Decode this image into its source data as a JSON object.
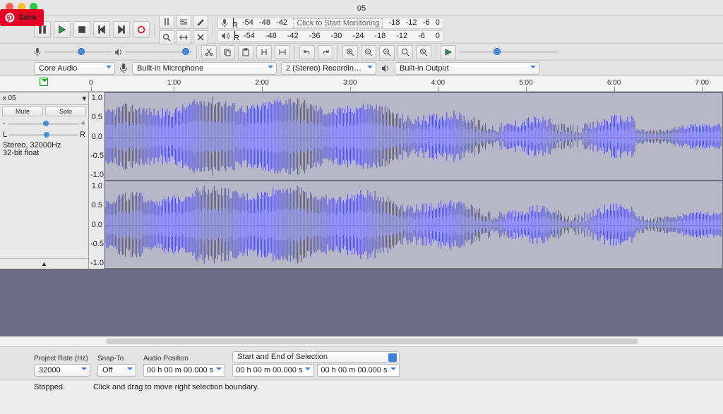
{
  "window": {
    "title": "05"
  },
  "pin_save": {
    "label": "Save"
  },
  "meters": {
    "rec_ticks": [
      "-54",
      "-48",
      "-42",
      "Click to Start Monitoring",
      "-18",
      "-12",
      "-6",
      "0"
    ],
    "play_ticks": [
      "-54",
      "-48",
      "-42",
      "-36",
      "-30",
      "-24",
      "-18",
      "-12",
      "-6",
      "0"
    ]
  },
  "device_bar": {
    "host": "Core Audio",
    "rec_device": "Built-in Microphone",
    "rec_channels": "2 (Stereo) Recordin…",
    "play_device": "Built-in Output"
  },
  "timeline": {
    "ticks": [
      "0",
      "1:00",
      "2:00",
      "3:00",
      "4:00",
      "5:00",
      "6:00",
      "7:00"
    ]
  },
  "track": {
    "name": "05",
    "mute": "Mute",
    "solo": "Solo",
    "pan_left": "L",
    "pan_right": "R",
    "gain_minus": "-",
    "gain_plus": "+",
    "info1": "Stereo, 32000Hz",
    "info2": "32-bit float",
    "axis": [
      "1.0",
      "0.5",
      "0.0",
      "-0.5",
      "-1.0"
    ]
  },
  "footer": {
    "project_rate_label": "Project Rate (Hz)",
    "project_rate": "32000",
    "snap_label": "Snap-To",
    "snap": "Off",
    "audio_pos_label": "Audio Position",
    "audio_pos": "00 h 00 m 00.000 s",
    "sel_header": "Start and End of Selection",
    "sel_start": "00 h 00 m 00.000 s",
    "sel_end": "00 h 00 m 00.000 s"
  },
  "status": {
    "state": "Stopped.",
    "hint": "Click and drag to move right selection boundary."
  }
}
